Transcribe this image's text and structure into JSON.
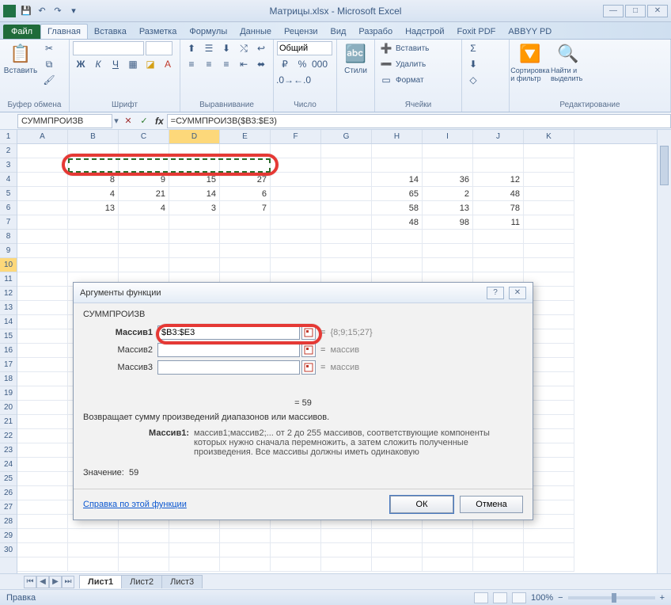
{
  "title": "Матрицы.xlsx - Microsoft Excel",
  "tabs": {
    "file": "Файл",
    "list": [
      "Главная",
      "Вставка",
      "Разметка",
      "Формулы",
      "Данные",
      "Рецензи",
      "Вид",
      "Разрабо",
      "Надстрой",
      "Foxit PDF",
      "ABBYY PD"
    ],
    "active_index": 0
  },
  "ribbon": {
    "paste": "Вставить",
    "clipboard": "Буфер обмена",
    "font_group": "Шрифт",
    "align_group": "Выравнивание",
    "number_group": "Число",
    "number_format": "Общий",
    "styles": "Стили",
    "cells_group": "Ячейки",
    "insert": "Вставить",
    "delete": "Удалить",
    "format": "Формат",
    "editing": "Редактирование",
    "sort": "Сортировка и фильтр",
    "find": "Найти и выделить"
  },
  "fx": {
    "namebox": "СУММПРОИЗВ",
    "formula": "=СУММПРОИЗВ($B3:$E3)"
  },
  "columns": [
    "A",
    "B",
    "C",
    "D",
    "E",
    "F",
    "G",
    "H",
    "I",
    "J",
    "K"
  ],
  "rows_count": 30,
  "grid_data": {
    "3": {
      "B": "8",
      "C": "9",
      "D": "15",
      "E": "27",
      "H": "14",
      "I": "36",
      "J": "12"
    },
    "4": {
      "B": "4",
      "C": "21",
      "D": "14",
      "E": "6",
      "H": "65",
      "I": "2",
      "J": "48"
    },
    "5": {
      "B": "13",
      "C": "4",
      "D": "3",
      "E": "7",
      "H": "58",
      "I": "13",
      "J": "78"
    },
    "6": {
      "H": "48",
      "I": "98",
      "J": "11"
    }
  },
  "active_col": "D",
  "active_row": 10,
  "dialog": {
    "title": "Аргументы функции",
    "func": "СУММПРОИЗВ",
    "args": [
      {
        "label": "Массив1",
        "value": "$B3:$E3",
        "preview": "{8;9;15;27}",
        "bold": true
      },
      {
        "label": "Массив2",
        "value": "",
        "preview": "массив",
        "bold": false
      },
      {
        "label": "Массив3",
        "value": "",
        "preview": "массив",
        "bold": false
      }
    ],
    "result_eq": "= 59",
    "description": "Возвращает сумму произведений диапазонов или массивов.",
    "arg_detail_k": "Массив1:",
    "arg_detail_v": "массив1;массив2;... от 2 до 255 массивов, соответствующие компоненты которых нужно сначала перемножить, а затем сложить полученные произведения. Все массивы должны иметь одинаковую",
    "value_label": "Значение:",
    "value": "59",
    "help": "Справка по этой функции",
    "ok": "ОК",
    "cancel": "Отмена"
  },
  "sheets": {
    "list": [
      "Лист1",
      "Лист2",
      "Лист3"
    ],
    "active": 0
  },
  "status": {
    "mode": "Правка",
    "zoom": "100%"
  }
}
